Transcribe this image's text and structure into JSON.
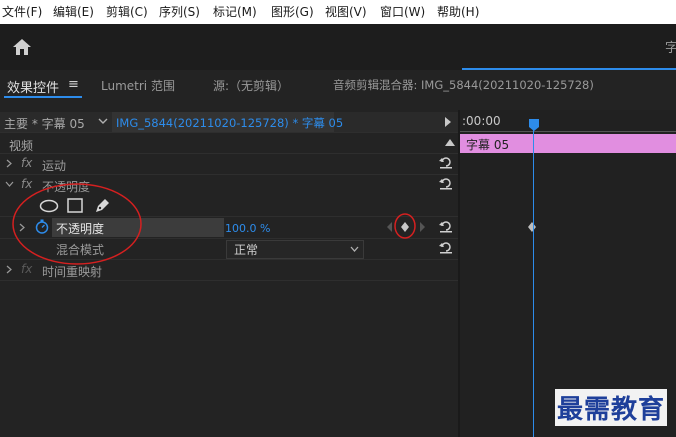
{
  "menu": {
    "items": [
      "文件(F)",
      "编辑(E)",
      "剪辑(C)",
      "序列(S)",
      "标记(M)",
      "图形(G)",
      "视图(V)",
      "窗口(W)",
      "帮助(H)"
    ],
    "right_glyph": "字"
  },
  "tabs": {
    "effect_controls": "效果控件",
    "menu_glyph": "≡",
    "lumetri": "Lumetri 范围",
    "source": "源:（无剪辑）",
    "audio_mixer": "音频剪辑混合器: IMG_5844(20211020-125728)"
  },
  "sequence_bar": {
    "master": "主要 * 字幕 05",
    "sequence": "IMG_5844(20211020-125728) * 字幕 05"
  },
  "panel": {
    "video_header": "视频",
    "fx_label": "fx",
    "motion": "运动",
    "opacity": "不透明度",
    "opacity_param": "不透明度",
    "opacity_value": "100.0 %",
    "blend_mode": "混合模式",
    "blend_value": "正常",
    "time_remap": "时间重映射"
  },
  "timeline": {
    "timecode": ":00:00",
    "clip_label": "字幕 05"
  },
  "watermark": "最需教育",
  "colors": {
    "accent_blue": "#2d8ceb",
    "clip_pink": "#e18ee0",
    "annotation_red": "#d42020"
  }
}
